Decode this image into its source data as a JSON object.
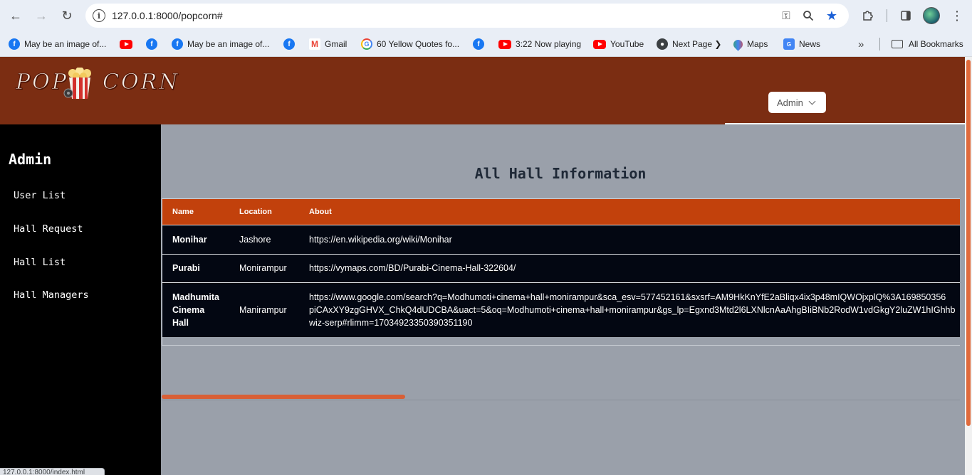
{
  "browser": {
    "url": "127.0.0.1:8000/popcorn#",
    "status_url": "127.0.0.1:8000/index.html",
    "bookmarks": [
      {
        "label": "May be an image of...",
        "icon": "facebook-icon"
      },
      {
        "label": "",
        "icon": "youtube-icon"
      },
      {
        "label": "",
        "icon": "facebook-icon"
      },
      {
        "label": "May be an image of...",
        "icon": "facebook-icon"
      },
      {
        "label": "",
        "icon": "facebook-icon"
      },
      {
        "label": "Gmail",
        "icon": "gmail-icon"
      },
      {
        "label": "60 Yellow Quotes fo...",
        "icon": "google-icon"
      },
      {
        "label": "",
        "icon": "facebook-icon"
      },
      {
        "label": "3:22 Now playing",
        "icon": "youtube-icon"
      },
      {
        "label": "YouTube",
        "icon": "youtube-icon"
      },
      {
        "label": "Next Page ❯",
        "icon": "globe-icon"
      },
      {
        "label": "Maps",
        "icon": "maps-icon"
      },
      {
        "label": "News",
        "icon": "news-icon"
      }
    ],
    "all_bookmarks": "All Bookmarks",
    "overflow": "»"
  },
  "header": {
    "logo_left": "POP",
    "logo_right": "CORN",
    "admin_dropdown": "Admin"
  },
  "sidebar": {
    "title": "Admin",
    "items": [
      {
        "label": "User List"
      },
      {
        "label": "Hall Request"
      },
      {
        "label": "Hall List"
      },
      {
        "label": "Hall Managers"
      }
    ]
  },
  "main": {
    "title": "All Hall Information",
    "columns": [
      "Name",
      "Location",
      "About"
    ],
    "rows": [
      {
        "name": "Monihar",
        "location": "Jashore",
        "about": "https://en.wikipedia.org/wiki/Monihar"
      },
      {
        "name": "Purabi",
        "location": "Monirampur",
        "about": "https://vymaps.com/BD/Purabi-Cinema-Hall-322604/"
      },
      {
        "name_lines": [
          "Madhumita",
          "Cinema",
          "Hall"
        ],
        "location": "Manirampur",
        "about_lines": [
          "https://www.google.com/search?q=Modhumoti+cinema+hall+monirampur&sca_esv=577452161&sxsrf=AM9HkKnYfE2aBliqx4ix3p48mIQWOjxplQ%3A169850356",
          "piCAxXY9zgGHVX_ChkQ4dUDCBA&uact=5&oq=Modhumoti+cinema+hall+monirampur&gs_lp=Egxnd3Mtd2l6LXNlcnAaAhgBIiBNb2RodW1vdGkgY2luZW1hIGhhb",
          "wiz-serp#rlimm=17034923350390351190"
        ]
      }
    ]
  },
  "colors": {
    "header_bg": "#7b2d12",
    "table_header_bg": "#c2410c",
    "row_bg": "#030712",
    "content_bg": "#9aa0aa",
    "scroll_thumb": "#d85f36"
  }
}
